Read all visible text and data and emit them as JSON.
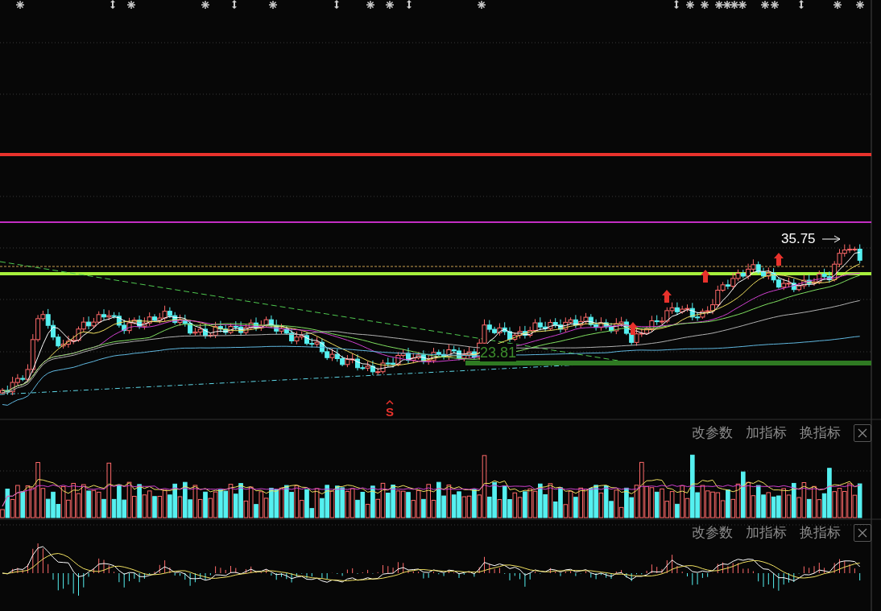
{
  "main_chart": {
    "high_label": "35.75",
    "support_label": "23.81",
    "signal_marker": "S"
  },
  "indicator_panels": [
    {
      "buttons": [
        "改参数",
        "加指标",
        "换指标"
      ]
    },
    {
      "buttons": [
        "改参数",
        "加指标",
        "换指标"
      ]
    }
  ]
}
